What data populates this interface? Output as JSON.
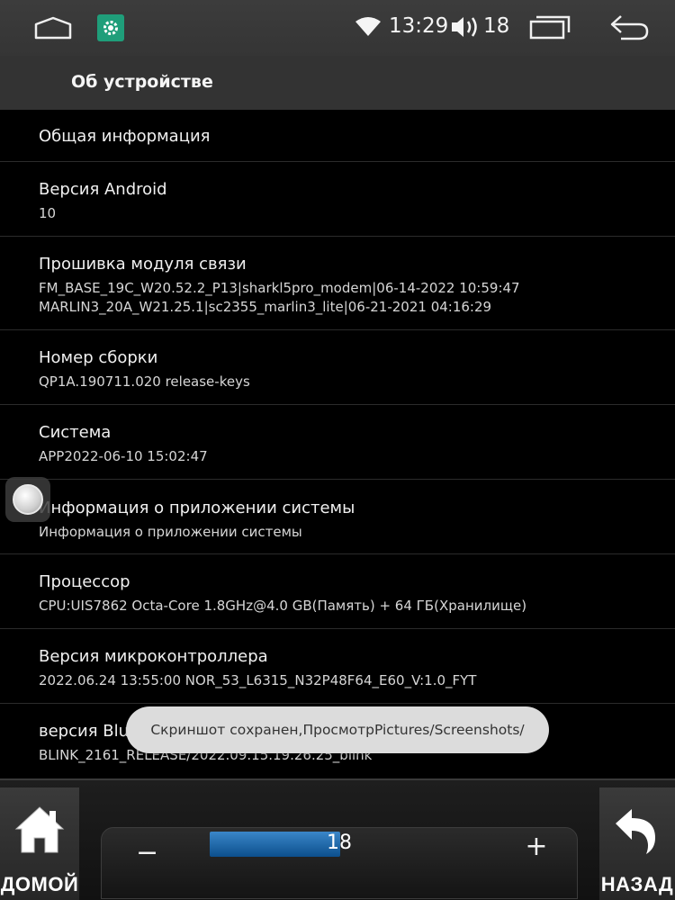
{
  "status_bar": {
    "icons": [
      "home-outline-icon",
      "settings-gear-icon",
      "wifi-icon",
      "volume-icon",
      "recents-icon",
      "back-arrow-icon"
    ],
    "time": "13:29",
    "volume_value": "18"
  },
  "header": {
    "title": "Об устройстве"
  },
  "items": [
    {
      "title": "Общая информация"
    },
    {
      "title": "Версия Android",
      "subtitle": "10"
    },
    {
      "title": "Прошивка модуля связи",
      "subtitle": "FM_BASE_19C_W20.52.2_P13|sharkl5pro_modem|06-14-2022 10:59:47",
      "subtitle2": "MARLIN3_20A_W21.25.1|sc2355_marlin3_lite|06-21-2021 04:16:29"
    },
    {
      "title": "Номер сборки",
      "subtitle": "QP1A.190711.020 release-keys"
    },
    {
      "title": "Система",
      "subtitle": "APP2022-06-10 15:02:47"
    },
    {
      "title": "Информация о приложении системы",
      "subtitle": "Информация о приложении системы"
    },
    {
      "title": "Процессор",
      "subtitle": "CPU:UIS7862 Octa-Core 1.8GHz@4.0 GB(Память) + 64 ГБ(Хранилище)"
    },
    {
      "title": "Версия микроконтроллера",
      "subtitle": "2022.06.24 13:55:00 NOR_53_L6315_N32P48F64_E60_V:1.0_FYT"
    },
    {
      "title": "версия Bluetooth",
      "subtitle": "BLINK_2161_RELEASE/2022.09.15.19.26.25_blink"
    }
  ],
  "toast": {
    "message": "Скриншот сохранен,ПросмотрPictures/Screenshots/"
  },
  "bottom_bar": {
    "home_label": "ДОМОЙ",
    "back_label": "НАЗАД",
    "volume": {
      "value": "18",
      "minus": "−",
      "plus": "+"
    }
  },
  "colors": {
    "background": "#000000",
    "header": "#333333",
    "accent_blue": "#1d6cb0",
    "settings_green": "#1f9e7a",
    "toast": "#dcdcdc"
  }
}
